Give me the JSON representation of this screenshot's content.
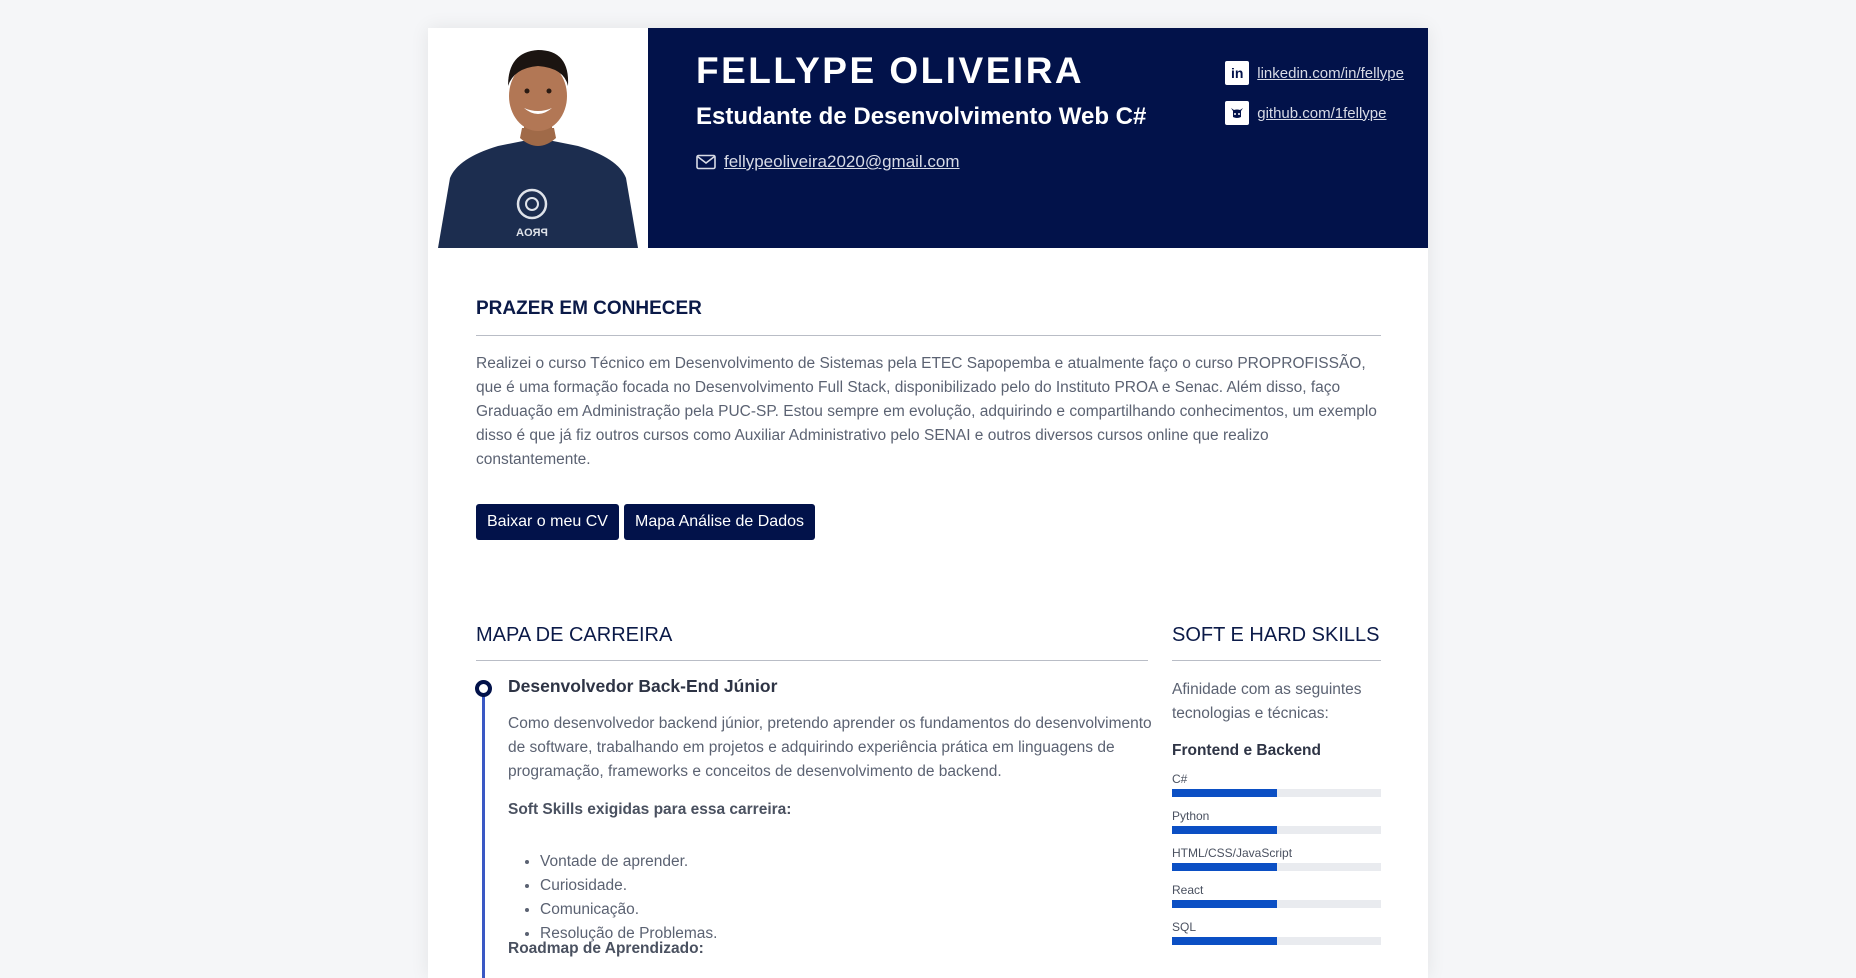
{
  "header": {
    "name": "FELLYPE OLIVEIRA",
    "role": "Estudante de Desenvolvimento Web C#",
    "email": " fellypeoliveira2020@gmail.com",
    "email_icon": "envelope-icon",
    "photo_badge": "PROA",
    "social": [
      {
        "icon": "linkedin-icon",
        "glyph": "in",
        "label": "linkedin.com/in/fellype"
      },
      {
        "icon": "github-icon",
        "glyph": "",
        "label": "github.com/1fellype"
      }
    ],
    "band_color": "#02124a"
  },
  "about": {
    "title": "PRAZER EM CONHECER",
    "text": "Realizei o curso Técnico em Desenvolvimento de Sistemas pela ETEC Sapopemba e atualmente faço o curso PROPROFISSÃO, que é uma formação focada no Desenvolvimento Full Stack, disponibilizado pelo do Instituto PROA e Senac. Além disso, faço Graduação em Administração pela PUC-SP. Estou sempre em evolução, adquirindo e compartilhando conhecimentos, um exemplo disso é que já fiz outros cursos como Auxiliar Administrativo pelo SENAI e outros diversos cursos online que realizo constantemente.",
    "buttons": [
      "Baixar o meu CV",
      "Mapa Análise de Dados"
    ]
  },
  "career": {
    "title": "MAPA DE CARREIRA",
    "item_title": "Desenvolvedor Back-End Júnior",
    "item_desc": "Como desenvolvedor backend júnior, pretendo aprender os fundamentos do desenvolvimento de software, trabalhando em projetos e adquirindo experiência prática em linguagens de programação, frameworks e conceitos de desenvolvimento de backend.",
    "soft_skills_heading": "Soft Skills exigidas para essa carreira:",
    "soft_skills": [
      "Vontade de aprender.",
      "Curiosidade.",
      "Comunicação.",
      "Resolução de Problemas."
    ],
    "roadmap_heading": "Roadmap de Aprendizado:"
  },
  "skills": {
    "title": "SOFT E HARD SKILLS",
    "intro": "Afinidade com as seguintes tecnologias e técnicas:",
    "group": "Frontend e Backend",
    "items": [
      {
        "label": "C#",
        "level": 0.5
      },
      {
        "label": "Python",
        "level": 0.5
      },
      {
        "label": "HTML/CSS/JavaScript",
        "level": 0.5
      },
      {
        "label": "React",
        "level": 0.5
      },
      {
        "label": "SQL",
        "level": 0.5
      }
    ],
    "bar_color": "#0b4fc4"
  }
}
